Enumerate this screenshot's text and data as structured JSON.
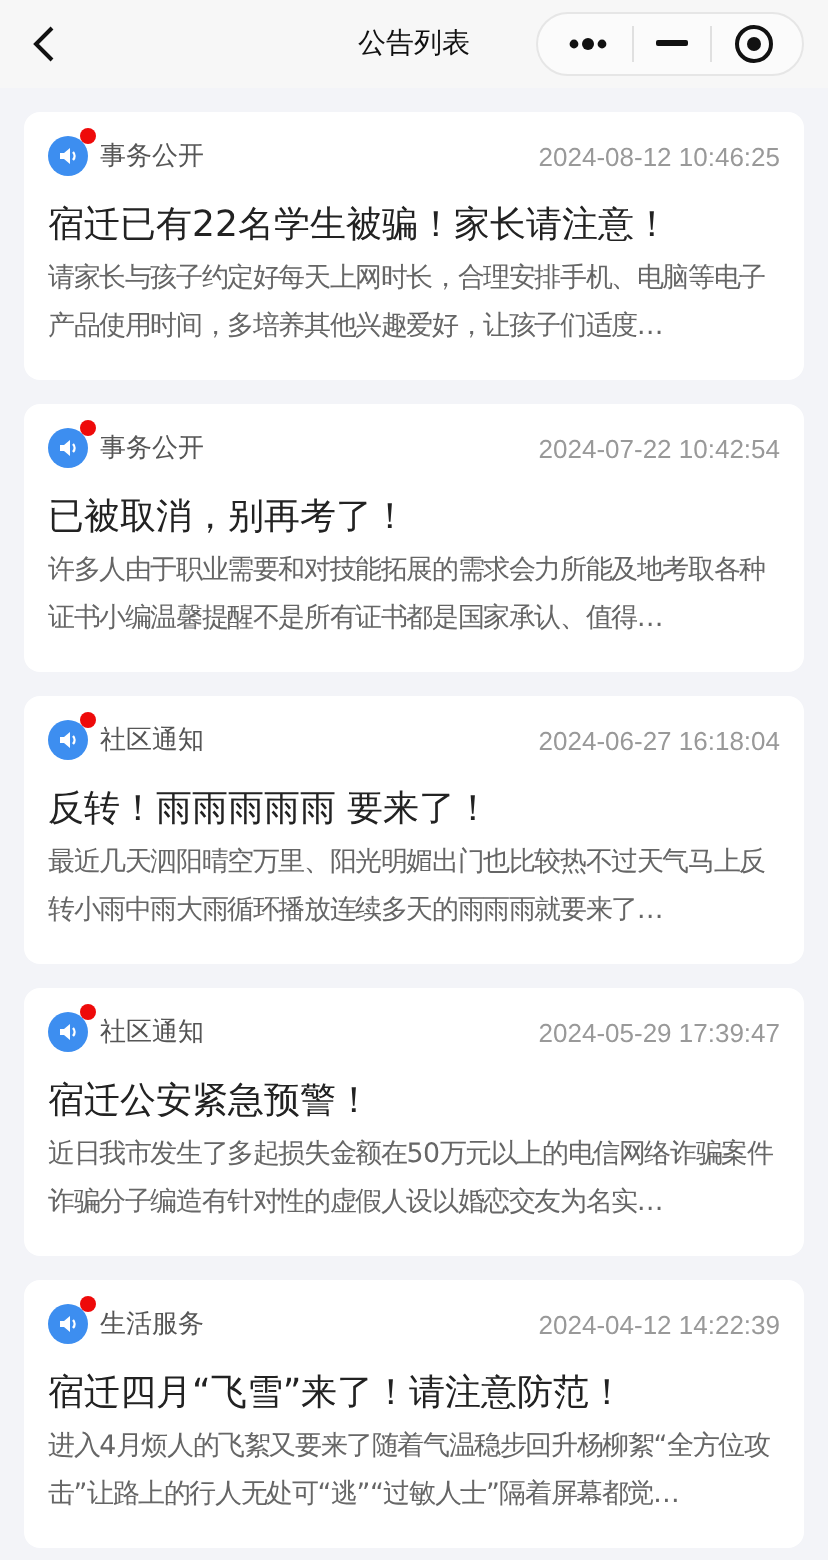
{
  "nav": {
    "title": "公告列表"
  },
  "notices": [
    {
      "category": "事务公开",
      "time": "2024-08-12 10:46:25",
      "unread": true,
      "title": "宿迁已有22名学生被骗！家长请注意！",
      "summary": "请家长与孩子约定好每天上网时长，合理安排手机、电脑等电子产品使用时间，多培养其他兴趣爱好，让孩子们适度…"
    },
    {
      "category": "事务公开",
      "time": "2024-07-22 10:42:54",
      "unread": true,
      "title": "已被取消，别再考了！",
      "summary": "许多人由于职业需要和对技能拓展的需求会力所能及地考取各种证书小编温馨提醒不是所有证书都是国家承认、值得…"
    },
    {
      "category": "社区通知",
      "time": "2024-06-27 16:18:04",
      "unread": true,
      "title": "反转！雨雨雨雨雨 要来了！",
      "summary": "最近几天泗阳晴空万里、阳光明媚出门也比较热不过天气马上反转小雨中雨大雨循环播放连续多天的雨雨雨就要来了…"
    },
    {
      "category": "社区通知",
      "time": "2024-05-29 17:39:47",
      "unread": true,
      "title": "宿迁公安紧急预警！",
      "summary": "近日我市发生了多起损失金额在50万元以上的电信网络诈骗案件诈骗分子编造有针对性的虚假人设以婚恋交友为名实…"
    },
    {
      "category": "生活服务",
      "time": "2024-04-12 14:22:39",
      "unread": true,
      "title": "宿迁四月“飞雪”来了！请注意防范！",
      "summary": "进入4月烦人的飞絮又要来了随着气温稳步回升杨柳絮“全方位攻击”让路上的行人无处可“逃”“过敏人士”隔着屏幕都觉…"
    }
  ]
}
